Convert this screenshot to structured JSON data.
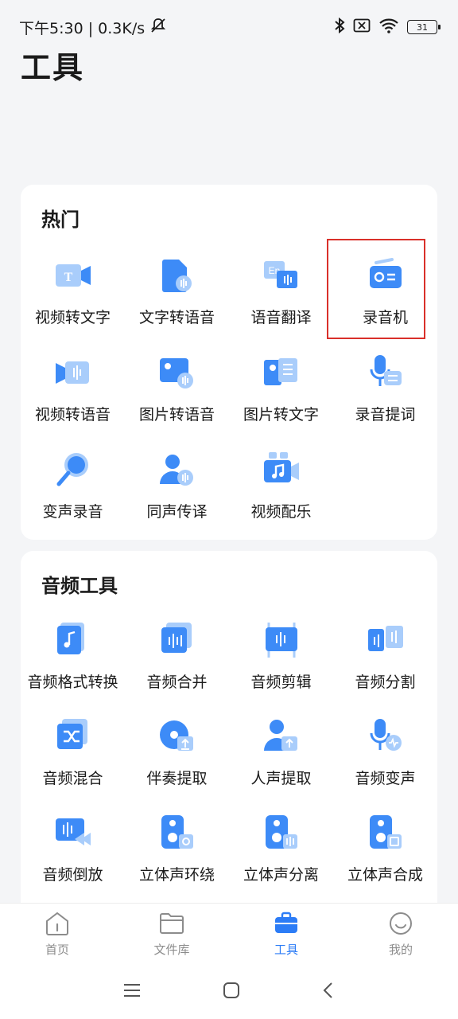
{
  "status": {
    "time_speed": "下午5:30 | 0.3K/s",
    "battery": "31"
  },
  "page_title": "工具",
  "hot": {
    "title": "热门",
    "items": [
      {
        "label": "视频转文字",
        "icon": "video-to-text-icon"
      },
      {
        "label": "文字转语音",
        "icon": "text-to-speech-icon"
      },
      {
        "label": "语音翻译",
        "icon": "speech-translate-icon"
      },
      {
        "label": "录音机",
        "icon": "recorder-icon"
      },
      {
        "label": "视频转语音",
        "icon": "video-to-audio-icon"
      },
      {
        "label": "图片转语音",
        "icon": "image-to-speech-icon"
      },
      {
        "label": "图片转文字",
        "icon": "image-to-text-icon"
      },
      {
        "label": "录音提词",
        "icon": "teleprompter-icon"
      },
      {
        "label": "变声录音",
        "icon": "voice-changer-record-icon"
      },
      {
        "label": "同声传译",
        "icon": "simultaneous-interpretation-icon"
      },
      {
        "label": "视频配乐",
        "icon": "video-music-icon"
      }
    ]
  },
  "audio": {
    "title": "音频工具",
    "items": [
      {
        "label": "音频格式转换",
        "icon": "audio-convert-icon"
      },
      {
        "label": "音频合并",
        "icon": "audio-merge-icon"
      },
      {
        "label": "音频剪辑",
        "icon": "audio-cut-icon"
      },
      {
        "label": "音频分割",
        "icon": "audio-split-icon"
      },
      {
        "label": "音频混合",
        "icon": "audio-mix-icon"
      },
      {
        "label": "伴奏提取",
        "icon": "accompaniment-extract-icon"
      },
      {
        "label": "人声提取",
        "icon": "vocal-extract-icon"
      },
      {
        "label": "音频变声",
        "icon": "audio-voice-change-icon"
      },
      {
        "label": "音频倒放",
        "icon": "audio-reverse-icon"
      },
      {
        "label": "立体声环绕",
        "icon": "stereo-surround-icon"
      },
      {
        "label": "立体声分离",
        "icon": "stereo-separate-icon"
      },
      {
        "label": "立体声合成",
        "icon": "stereo-compose-icon"
      }
    ]
  },
  "tabs": [
    {
      "label": "首页",
      "icon": "home-icon",
      "active": false
    },
    {
      "label": "文件库",
      "icon": "folder-icon",
      "active": false
    },
    {
      "label": "工具",
      "icon": "toolbox-icon",
      "active": true
    },
    {
      "label": "我的",
      "icon": "profile-icon",
      "active": false
    }
  ],
  "colors": {
    "accent": "#2c7cf6",
    "icon_blue": "#3d8bf7",
    "icon_light": "#a9cdfb",
    "highlight_border": "#d9302a"
  }
}
